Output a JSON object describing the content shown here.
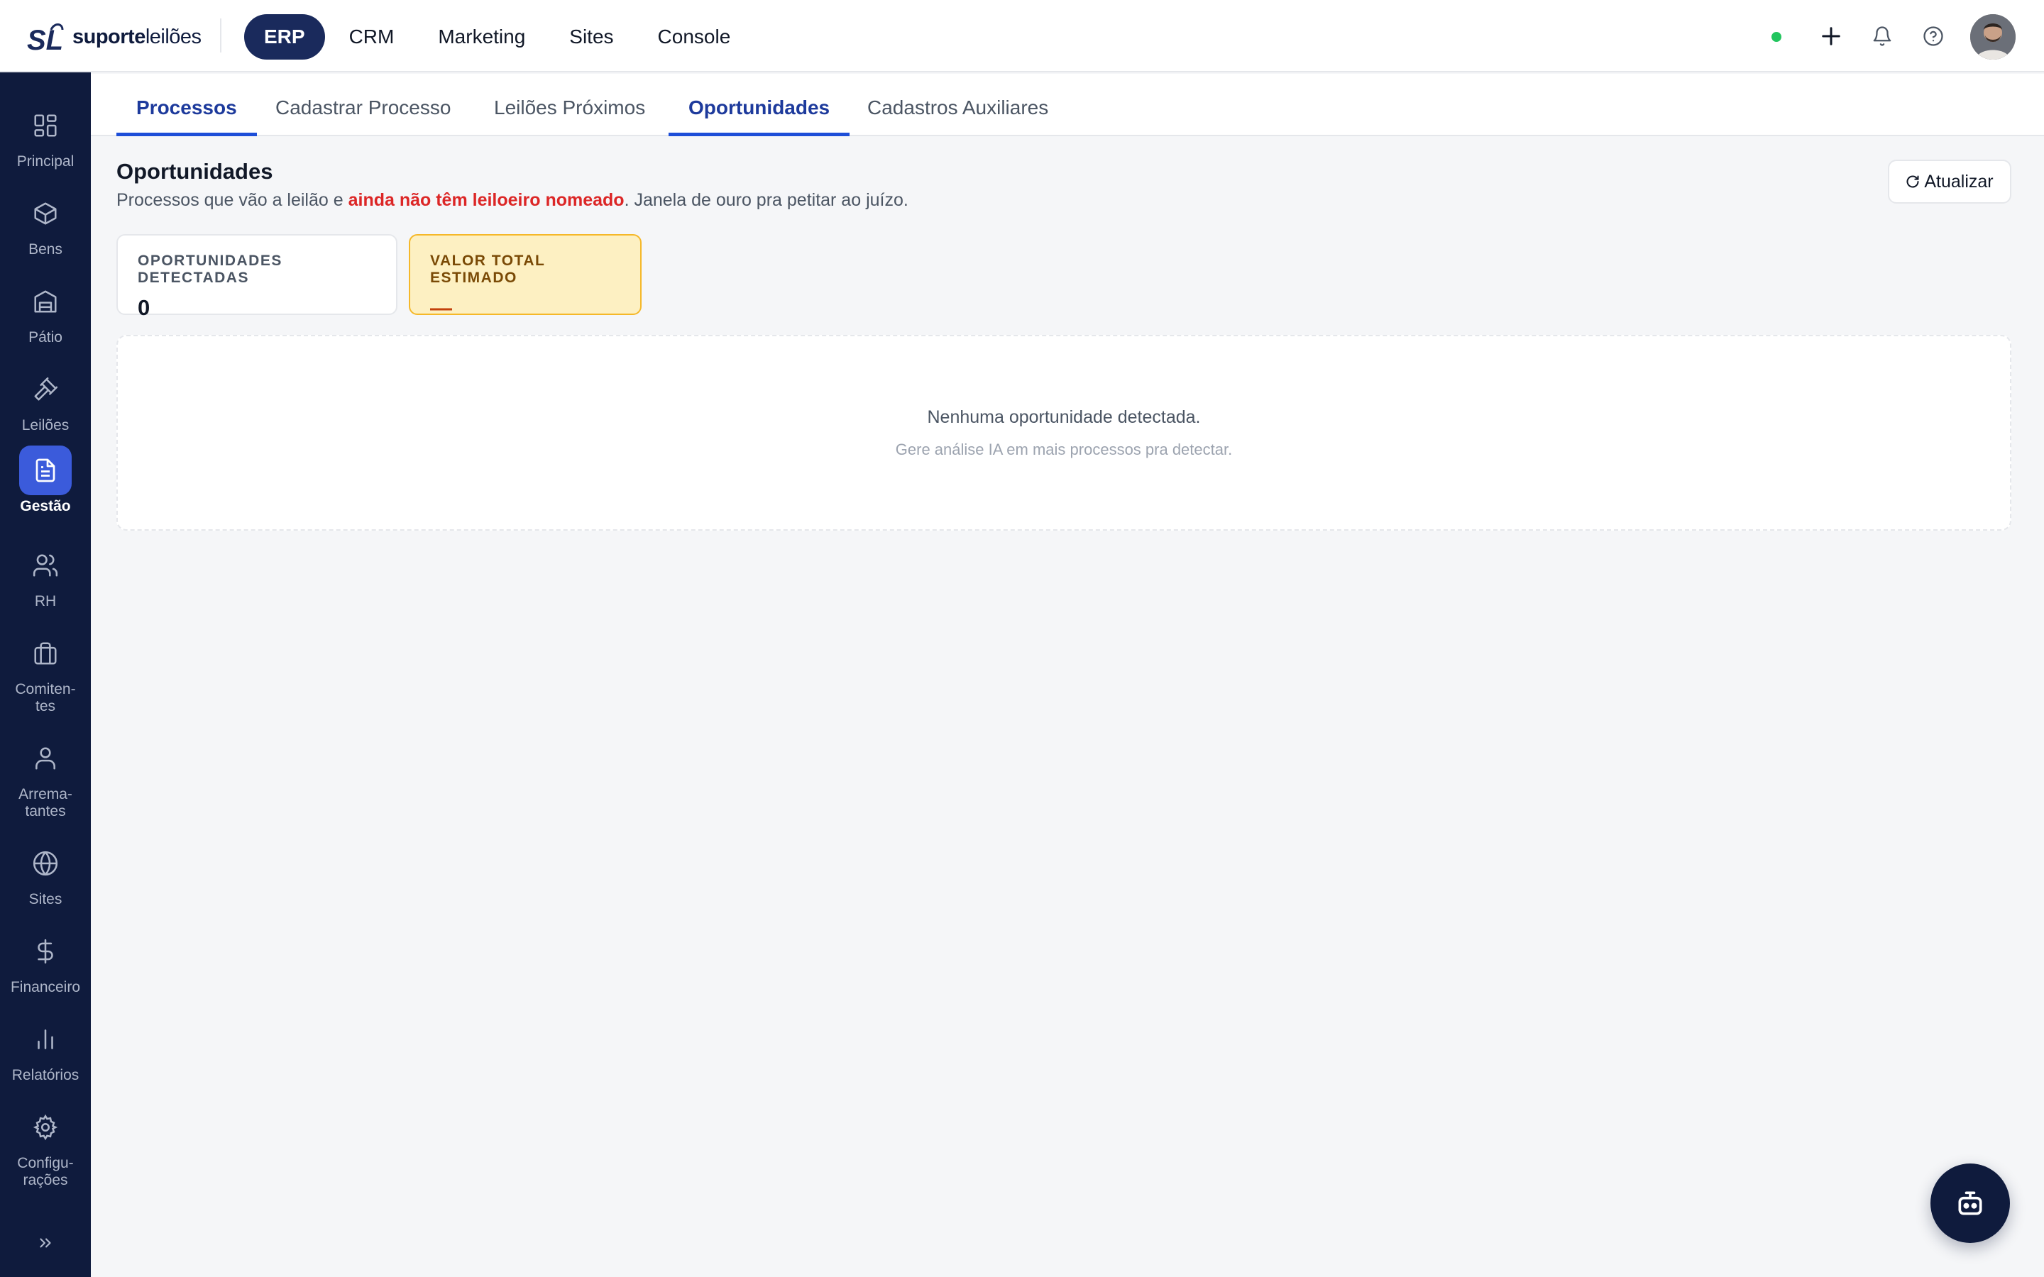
{
  "brand": {
    "name_bold": "suporte",
    "name_light": "leilões",
    "mark": "SL"
  },
  "topnav": [
    "ERP",
    "CRM",
    "Marketing",
    "Sites",
    "Console"
  ],
  "topnav_active": "ERP",
  "sidebar": {
    "items": [
      {
        "label": "Principal",
        "icon": "grid-icon"
      },
      {
        "label": "Bens",
        "icon": "box-icon"
      },
      {
        "label": "Pátio",
        "icon": "warehouse-icon"
      },
      {
        "label": "Leilões",
        "icon": "gavel-icon"
      },
      {
        "label": "Gestão",
        "icon": "document-icon"
      },
      {
        "label": "RH",
        "icon": "users-icon"
      },
      {
        "label": "Comiten-\ntes",
        "icon": "briefcase-icon"
      },
      {
        "label": "Arrema-\ntantes",
        "icon": "user-icon"
      },
      {
        "label": "Sites",
        "icon": "globe-icon"
      },
      {
        "label": "Financeiro",
        "icon": "dollar-icon"
      },
      {
        "label": "Relatórios",
        "icon": "bar-chart-icon"
      },
      {
        "label": "Configu-\nrações",
        "icon": "gear-icon"
      }
    ],
    "active": "Gestão"
  },
  "tabs": {
    "items": [
      "Processos",
      "Cadastrar Processo",
      "Leilões Próximos",
      "Oportunidades",
      "Cadastros Auxiliares"
    ],
    "active": [
      "Processos",
      "Oportunidades"
    ]
  },
  "page": {
    "title": "Oportunidades",
    "subtitle_pre": "Processos que vão a leilão e ",
    "subtitle_highlight": "ainda não têm leiloeiro nomeado",
    "subtitle_post": ". Janela de ouro pra petitar ao juízo.",
    "refresh_label": "Atualizar"
  },
  "stats": {
    "detected_label": "OPORTUNIDADES DETECTADAS",
    "detected_value": "0",
    "total_label": "VALOR TOTAL ESTIMADO",
    "total_value": "—"
  },
  "empty": {
    "title": "Nenhuma oportunidade detectada.",
    "subtitle": "Gere análise IA em mais processos pra detectar."
  },
  "colors": {
    "sidebar_bg": "#0f1b3d",
    "accent": "#1d4ed8",
    "highlight_red": "#dc2626",
    "status_online": "#22c55e",
    "warn_bg": "#fdf0c2",
    "warn_border": "#f5b829"
  }
}
